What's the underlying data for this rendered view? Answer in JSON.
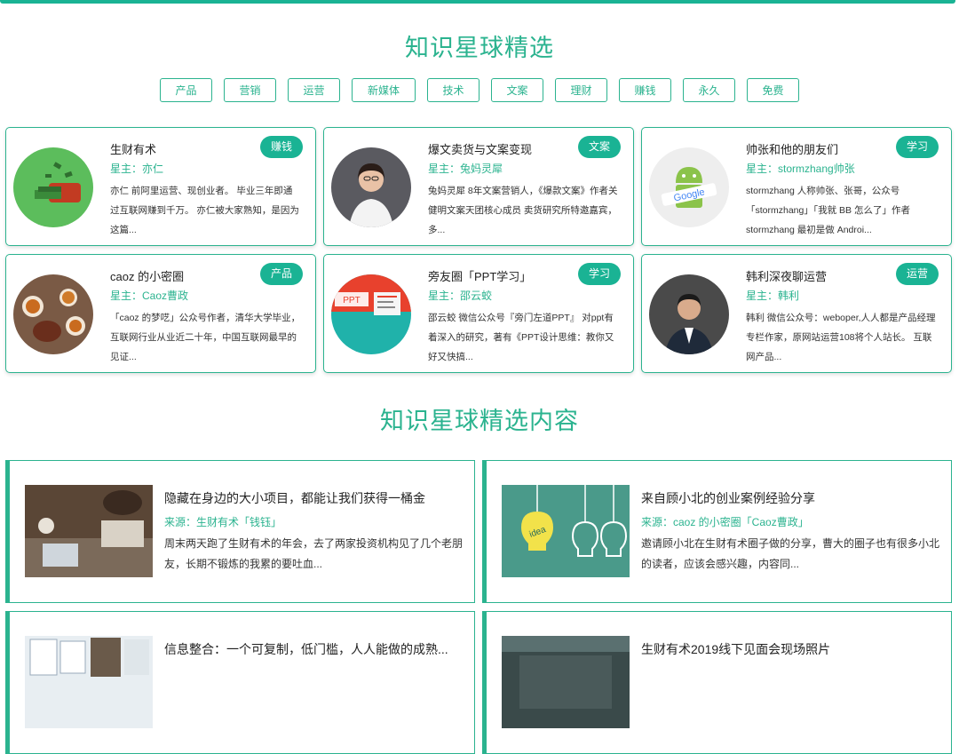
{
  "page": {
    "title": "知识星球精选",
    "content_title": "知识星球精选内容",
    "accent_color": "#1ab394"
  },
  "filters": [
    "产品",
    "营销",
    "运营",
    "新媒体",
    "技术",
    "文案",
    "理财",
    "赚钱",
    "永久",
    "免费"
  ],
  "planets": [
    {
      "title": "生财有术",
      "owner": "星主：亦仁",
      "badge": "赚钱",
      "desc": "亦仁 前阿里运营、现创业者。 毕业三年即通过互联网赚到千万。 亦仁被大家熟知，是因为这篇...",
      "icon": "money-bag-icon"
    },
    {
      "title": "爆文卖货与文案变现",
      "owner": "星主：兔妈灵犀",
      "badge": "文案",
      "desc": "兔妈灵犀 8年文案营销人，《爆款文案》作者关健明文案天团核心成员 卖货研究所特邀嘉宾，多...",
      "icon": "woman-avatar"
    },
    {
      "title": "帅张和他的朋友们",
      "owner": "星主：stormzhang帅张",
      "badge": "学习",
      "desc": "stormzhang 人称帅张、张哥，公众号「stormzhang」「我就 BB 怎么了」作者 stormzhang 最初是做 Androi...",
      "icon": "android-google-icon"
    },
    {
      "title": "caoz 的小密圈",
      "owner": "星主：Caoz曹政",
      "badge": "产品",
      "desc": "「caoz 的梦呓」公众号作者，清华大学毕业，互联网行业从业近二十年，中国互联网最早的见证...",
      "icon": "tea-set-icon"
    },
    {
      "title": "旁友圈「PPT学习」",
      "owner": "星主：邵云蛟",
      "badge": "学习",
      "desc": "邵云蛟 微信公众号『旁门左道PPT』 对ppt有着深入的研究，著有《PPT设计思维：教你又好又快搞...",
      "icon": "ppt-book-icon"
    },
    {
      "title": "韩利深夜聊运营",
      "owner": "星主：韩利",
      "badge": "运营",
      "desc": "韩利 微信公众号：weboper,人人都是产品经理专栏作家，原网站运营108将个人站长。 互联网产品...",
      "icon": "man-avatar"
    }
  ],
  "posts": [
    {
      "title": "隐藏在身边的大小项目，都能让我们获得一桶金",
      "source": "来源：生财有术「钱钰」",
      "desc": "周末两天跑了生财有术的年会，去了两家投资机构见了几个老朋友，长期不锻炼的我累的要吐血..."
    },
    {
      "title": "来自顾小北的创业案例经验分享",
      "source": "来源：caoz 的小密圈「Caoz曹政」",
      "desc": "邀请顾小北在生财有术圈子做的分享，曹大的圈子也有很多小北的读者，应该会感兴趣，内容同..."
    },
    {
      "title": "信息整合：一个可复制，低门槛，人人能做的成熟...",
      "source": "",
      "desc": ""
    },
    {
      "title": "生财有术2019线下见面会现场照片",
      "source": "",
      "desc": ""
    }
  ]
}
